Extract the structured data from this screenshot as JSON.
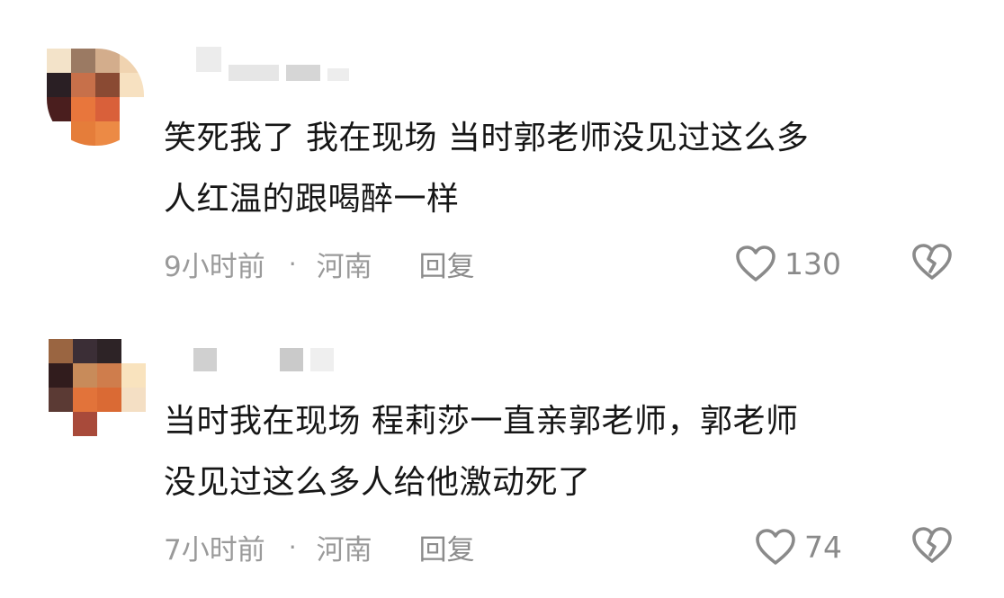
{
  "comments": [
    {
      "text_line1": "笑死我了 我在现场 当时郭老师没见过这么多",
      "text_line2": "人红温的跟喝醉一样",
      "time": "9小时前",
      "separator": "·",
      "location": "河南",
      "reply_label": "回复",
      "like_count": "130",
      "like_icon": "heart-outline-icon",
      "dislike_icon": "broken-heart-icon"
    },
    {
      "text_line1": "当时我在现场 程莉莎一直亲郭老师，郭老师",
      "text_line2": "没见过这么多人给他激动死了",
      "time": "7小时前",
      "separator": "·",
      "location": "河南",
      "reply_label": "回复",
      "like_count": "74",
      "like_icon": "heart-outline-icon",
      "dislike_icon": "broken-heart-icon"
    }
  ],
  "colors": {
    "text": "#161616",
    "meta": "#9a9a9a",
    "icon": "#8a8a8a",
    "background": "#ffffff"
  }
}
